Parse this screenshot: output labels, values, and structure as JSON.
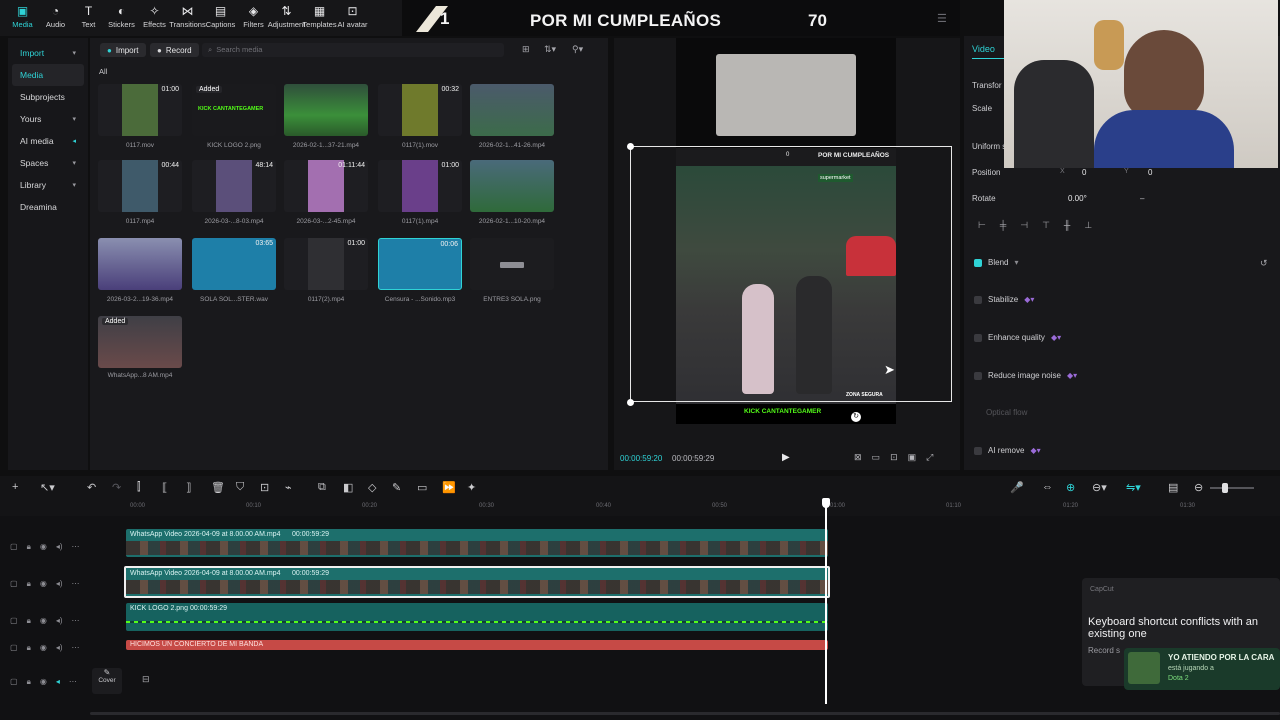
{
  "toolbar": {
    "items": [
      {
        "label": "Media",
        "icon": "media-icon",
        "active": true
      },
      {
        "label": "Audio",
        "icon": "audio-icon"
      },
      {
        "label": "Text",
        "icon": "text-icon"
      },
      {
        "label": "Stickers",
        "icon": "stickers-icon"
      },
      {
        "label": "Effects",
        "icon": "effects-icon"
      },
      {
        "label": "Transitions",
        "icon": "transitions-icon"
      },
      {
        "label": "Captions",
        "icon": "captions-icon"
      },
      {
        "label": "Filters",
        "icon": "filters-icon"
      },
      {
        "label": "Adjustment",
        "icon": "adjustment-icon"
      },
      {
        "label": "Templates",
        "icon": "templates-icon"
      },
      {
        "label": "AI avatar",
        "icon": "ai-avatar-icon"
      }
    ]
  },
  "banner": {
    "left_number": "1",
    "title": "POR MI CUMPLEAÑOS",
    "right_number": "70"
  },
  "leftnav": {
    "items": [
      {
        "label": "Import",
        "chevron": true,
        "selected": true
      },
      {
        "label": "Media",
        "selected": true
      },
      {
        "label": "Subprojects"
      },
      {
        "label": "Yours",
        "chevron": true
      },
      {
        "label": "AI media",
        "chevron": true
      },
      {
        "label": "Spaces",
        "chevron": true
      },
      {
        "label": "Library",
        "chevron": true
      },
      {
        "label": "Dreamina"
      }
    ]
  },
  "media": {
    "import_label": "Import",
    "record_label": "Record",
    "search_placeholder": "Search media",
    "filter_label": "All",
    "items": [
      {
        "name": "0117.mov",
        "duration": "01:00"
      },
      {
        "name": "KICK LOGO 2.png",
        "added": "Added",
        "logo": "KICK CANTANTEGAMER"
      },
      {
        "name": "2026-02-1...37-21.mp4",
        "duration": ""
      },
      {
        "name": "0117(1).mov",
        "duration": "00:32"
      },
      {
        "name": "2026-02-1...41-26.mp4",
        "duration": ""
      },
      {
        "name": "0117.mp4",
        "duration": "00:44"
      },
      {
        "name": "2026-03-...8-03.mp4",
        "duration": "48:14"
      },
      {
        "name": "2026-03-...2-45.mp4",
        "duration": "01:11:44"
      },
      {
        "name": "0117(1).mp4",
        "duration": "01:00"
      },
      {
        "name": "2026-02-1...10-20.mp4",
        "duration": ""
      },
      {
        "name": "2026-03-2...19-36.mp4",
        "duration": ""
      },
      {
        "name": "SOLA SOL...STER.wav",
        "duration": "03:65"
      },
      {
        "name": "0117(2).mp4",
        "duration": "01:00"
      },
      {
        "name": "Censura - ...Sonido.mp3",
        "duration": "00:06"
      },
      {
        "name": "ENTRE3 SOLA.png",
        "duration": ""
      },
      {
        "name": "WhatsApp...8 AM.mp4",
        "added": "Added"
      }
    ]
  },
  "player": {
    "current_time": "00:00:59:20",
    "total_time": "00:00:59:29",
    "overlay_title": "POR MI CUMPLEAÑOS",
    "overlay_counter": "0",
    "supermarket": "supermarket",
    "zona": "ZONA SEGURA",
    "kick_logo": "KICK CANTANTEGAMER"
  },
  "rightpanel": {
    "tab": "Video",
    "transform": "Transfor",
    "scale": "Scale",
    "uniform": "Uniform s",
    "position_label": "Position",
    "pos_x_label": "X",
    "pos_x": "0",
    "pos_y_label": "Y",
    "pos_y": "0",
    "rotate_label": "Rotate",
    "rotate_value": "0.00°",
    "rotate_dash": "–",
    "blend": "Blend",
    "stabilize": "Stabilize",
    "enhance": "Enhance quality",
    "reduce_noise": "Reduce image noise",
    "optical_flow": "Optical flow",
    "ai_remove": "AI remove"
  },
  "timeline": {
    "ruler": [
      "00:00",
      "00:10",
      "00:20",
      "00:30",
      "00:40",
      "00:50",
      "01:00",
      "01:10",
      "01:20",
      "01:30"
    ],
    "tracks": [
      {
        "name": "WhatsApp Video 2026-04-09 at 8.00.00 AM.mp4",
        "duration": "00:00:59:29"
      },
      {
        "name": "WhatsApp Video 2026-04-09 at 8.00.00 AM.mp4",
        "duration": "00:00:59:29"
      },
      {
        "name": "KICK LOGO 2.png",
        "duration": "00:00:59:29"
      },
      {
        "name": "HICIMOS UN CONCIERTO DE MI BANDA",
        "duration": ""
      }
    ],
    "cover_label": "Cover"
  },
  "toast": {
    "app": "CapCut",
    "message": "Keyboard shortcut conflicts with an existing one",
    "sub": "Record s",
    "notif_title": "YO ATIENDO POR LA CARA",
    "notif_line": "está jugando a",
    "notif_game": "Dota 2"
  },
  "colors": {
    "accent": "#2fd3d6",
    "clip": "#1d6f6c",
    "audio_clip": "#c64a46"
  }
}
